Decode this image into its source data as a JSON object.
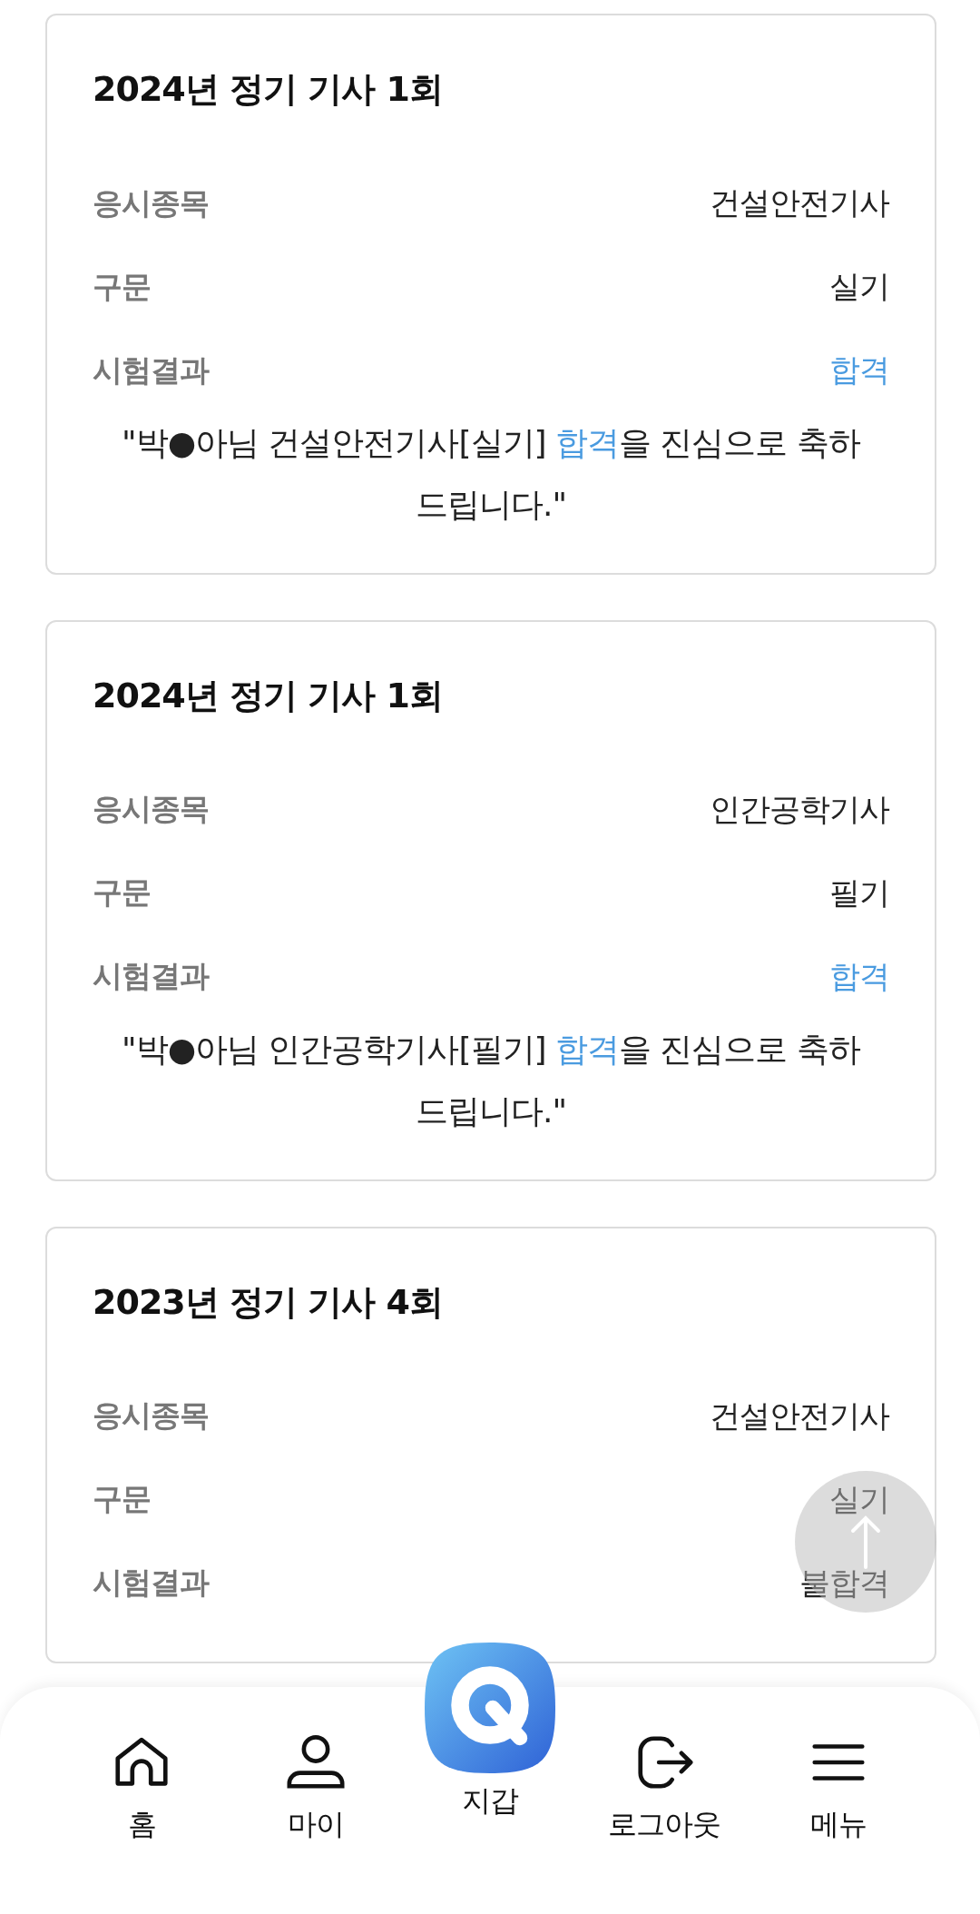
{
  "records": [
    {
      "title": "2024년 정기 기사 1회",
      "rows": [
        {
          "label": "응시종목",
          "value": "건설안전기사"
        },
        {
          "label": "구문",
          "value": "실기"
        },
        {
          "label": "시험결과",
          "value": "합격",
          "kind": "result",
          "passed": true
        }
      ],
      "message": "\"박●아님 건설안전기사[실기] **합격**을 진심으로 축하드립니다.\""
    },
    {
      "title": "2024년 정기 기사 1회",
      "rows": [
        {
          "label": "응시종목",
          "value": "인간공학기사"
        },
        {
          "label": "구문",
          "value": "필기"
        },
        {
          "label": "시험결과",
          "value": "합격",
          "kind": "result",
          "passed": true
        }
      ],
      "message": "\"박●아님 인간공학기사[필기] **합격**을 진심으로 축하드립니다.\""
    },
    {
      "title": "2023년 정기 기사 4회",
      "rows": [
        {
          "label": "응시종목",
          "value": "건설안전기사"
        },
        {
          "label": "구문",
          "value": "실기"
        },
        {
          "label": "시험결과",
          "value": "불합격",
          "kind": "result",
          "passed": false
        }
      ]
    }
  ],
  "nav": [
    {
      "kind": "home",
      "label": "홈"
    },
    {
      "kind": "my",
      "label": "마이"
    },
    {
      "kind": "wallet",
      "label": "지갑"
    },
    {
      "kind": "logout",
      "label": "로그아웃"
    },
    {
      "kind": "menu",
      "label": "메뉴"
    }
  ]
}
